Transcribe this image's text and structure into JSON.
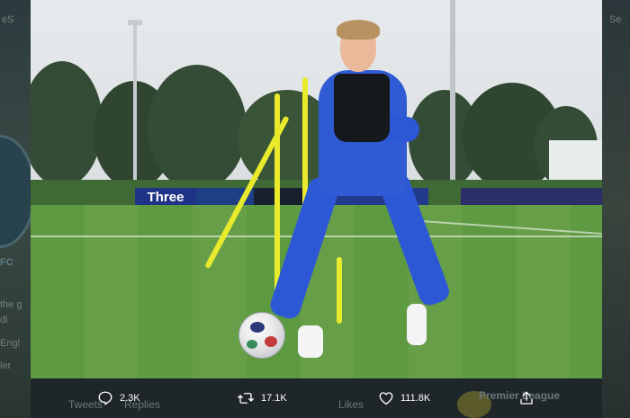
{
  "photo": {
    "sponsor_board": "Three"
  },
  "backdrop_left": {
    "text_lines": [
      "eS",
      "the g",
      "di",
      "Engl",
      "ler",
      "FC"
    ]
  },
  "backdrop_right": {
    "text_lines": [
      "Se"
    ]
  },
  "actions": {
    "reply": {
      "icon": "reply-icon",
      "count": "2.3K"
    },
    "retweet": {
      "icon": "retweet-icon",
      "count": "17.1K"
    },
    "like": {
      "icon": "heart-icon",
      "count": "111.8K"
    },
    "share": {
      "icon": "share-icon"
    }
  },
  "background_bar": {
    "tweets": "Tweets",
    "replies": "Replies",
    "likes": "Likes",
    "account": "Premier League"
  },
  "colors": {
    "bar_background": "#1f2629",
    "action_text": "#ffffff",
    "shirt": "#2f5bd4",
    "pitch": "#5e9a42",
    "training_poles": "#e9ea2c"
  }
}
